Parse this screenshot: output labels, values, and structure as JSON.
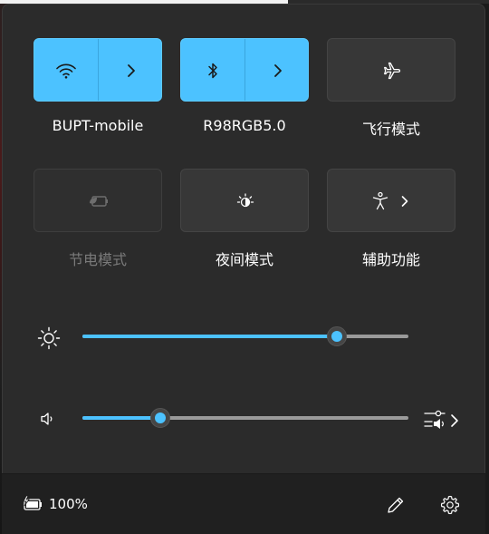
{
  "quick_settings": {
    "tiles": [
      {
        "label": "BUPT-mobile",
        "state": "active",
        "icon": "wifi-icon",
        "has_expand": true
      },
      {
        "label": "R98RGB5.0",
        "state": "active",
        "icon": "bluetooth-icon",
        "has_expand": true
      },
      {
        "label": "飞行模式",
        "state": "inactive",
        "icon": "airplane-icon",
        "has_expand": false
      },
      {
        "label": "节电模式",
        "state": "disabled",
        "icon": "battery-saver-icon",
        "has_expand": false
      },
      {
        "label": "夜间模式",
        "state": "inactive",
        "icon": "night-light-icon",
        "has_expand": false
      },
      {
        "label": "辅助功能",
        "state": "inactive",
        "icon": "accessibility-icon",
        "has_expand": true
      }
    ],
    "brightness": {
      "icon": "brightness-icon",
      "level": 0.78
    },
    "volume": {
      "icon": "speaker-icon",
      "level": 0.24,
      "output_icon": "audio-output-icon"
    }
  },
  "footer": {
    "battery_icon": "battery-charging-icon",
    "battery_percent": "100%",
    "edit_icon": "pencil-icon",
    "settings_icon": "gear-icon"
  },
  "colors": {
    "accent": "#4cc2ff",
    "panel": "#2b2b2b",
    "footer": "#202020"
  }
}
